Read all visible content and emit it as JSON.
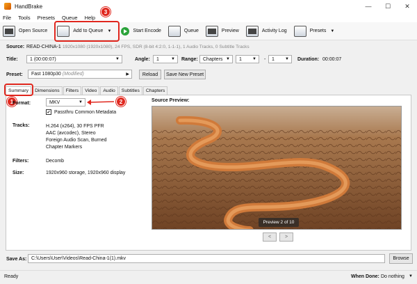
{
  "window": {
    "title": "HandBrake",
    "minimize": "—",
    "maximize": "☐",
    "close": "✕"
  },
  "menu": {
    "file": "File",
    "tools": "Tools",
    "presets": "Presets",
    "queue": "Queue",
    "help": "Help"
  },
  "toolbar": {
    "open_source": "Open Source",
    "add_to_queue": "Add to Queue",
    "start_encode": "Start Encode",
    "queue": "Queue",
    "preview": "Preview",
    "activity_log": "Activity Log",
    "presets": "Presets"
  },
  "source": {
    "label": "Source:",
    "name": "READ-CHINA-1",
    "details": "1920x1080 (1920x1080), 24 FPS, SDR (8-bit 4:2:0, 1-1-1), 1 Audio Tracks, 0 Subtitle Tracks"
  },
  "title_row": {
    "title_label": "Title:",
    "title_value": "1 (00:00:07)",
    "angle_label": "Angle:",
    "angle_value": "1",
    "range_label": "Range:",
    "range_type": "Chapters",
    "range_start": "1",
    "range_sep": "-",
    "range_end": "1",
    "duration_label": "Duration:",
    "duration_value": "00:00:07"
  },
  "preset_row": {
    "label": "Preset:",
    "value": "Fast 1080p30",
    "modified": "(Modified)",
    "reload": "Reload",
    "save_new": "Save New Preset"
  },
  "tabs": [
    "Summary",
    "Dimensions",
    "Filters",
    "Video",
    "Audio",
    "Subtitles",
    "Chapters"
  ],
  "summary": {
    "format_label": "Format:",
    "format_value": "MKV",
    "passthru_label": "Passthru Common Metadata",
    "tracks_label": "Tracks:",
    "tracks": [
      "H.264 (x264), 30 FPS PFR",
      "AAC (avcodec), Stereo",
      "Foreign Audio Scan, Burned",
      "Chapter Markers"
    ],
    "filters_label": "Filters:",
    "filters_value": "Decomb",
    "size_label": "Size:",
    "size_value": "1920x960 storage, 1920x960 display"
  },
  "preview": {
    "label": "Source Preview:",
    "badge": "Preview 2 of 10",
    "prev": "<",
    "next": ">"
  },
  "save_as": {
    "label": "Save As:",
    "path": "C:\\Users\\User\\Videos\\Read-China-1(1).mkv",
    "browse": "Browse"
  },
  "status": {
    "text": "Ready",
    "when_done_label": "When Done:",
    "when_done_value": "Do nothing"
  },
  "annotations": {
    "step1": "1",
    "step2": "2",
    "step3": "3"
  },
  "colors": {
    "annotation_red": "#e0271e",
    "play_green": "#2aa33a"
  }
}
